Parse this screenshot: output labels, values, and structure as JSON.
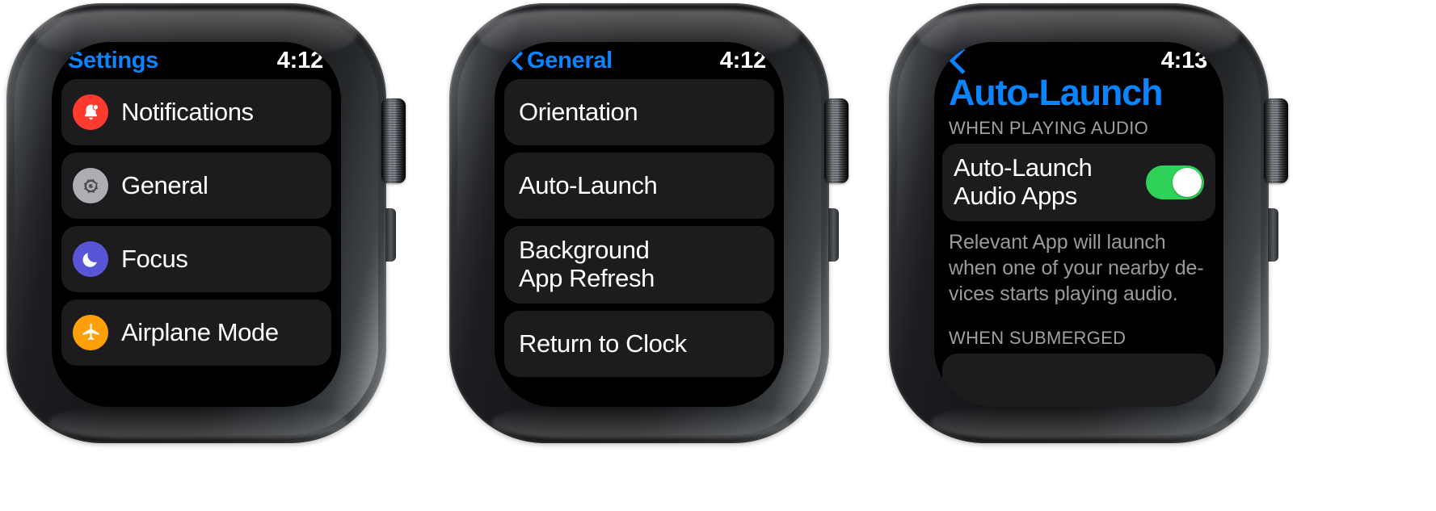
{
  "watches": [
    {
      "id": "settings",
      "status": {
        "title": "Settings",
        "time": "4:12",
        "has_back": false
      },
      "rows": [
        {
          "label": "Notifications",
          "icon": "bell-icon",
          "icon_bg": "#ff3b30"
        },
        {
          "label": "General",
          "icon": "gear-icon",
          "icon_bg": "#aeaeb2"
        },
        {
          "label": "Focus",
          "icon": "moon-icon",
          "icon_bg": "#5856d6"
        },
        {
          "label": "Airplane Mode",
          "icon": "airplane-icon",
          "icon_bg": "#ff9f0a"
        }
      ]
    },
    {
      "id": "general",
      "status": {
        "title": "General",
        "time": "4:12",
        "has_back": true
      },
      "rows": [
        {
          "label": "Orientation"
        },
        {
          "label": "Auto-Launch"
        },
        {
          "label": "Background\nApp Refresh"
        },
        {
          "label": "Return to Clock"
        }
      ]
    },
    {
      "id": "auto-launch",
      "status": {
        "title": "",
        "time": "4:13",
        "has_back": true
      },
      "page_title": "Auto-Launch",
      "sections": [
        {
          "header": "WHEN PLAYING AUDIO",
          "row": {
            "label": "Auto-Launch\nAudio Apps",
            "toggle_on": true
          },
          "footnote": "Relevant App will launch when one of your nearby de-vices starts playing audio."
        },
        {
          "header": "WHEN SUBMERGED"
        }
      ]
    }
  ],
  "colors": {
    "accent_blue": "#0a84ff",
    "toggle_green": "#30d158",
    "row_bg": "#1c1c1e",
    "screen_bg": "#000000",
    "label_gray": "#9a9a9a",
    "notifications_red": "#ff3b30",
    "general_gray": "#aeaeb2",
    "focus_purple": "#5856d6",
    "airplane_orange": "#ff9f0a"
  }
}
